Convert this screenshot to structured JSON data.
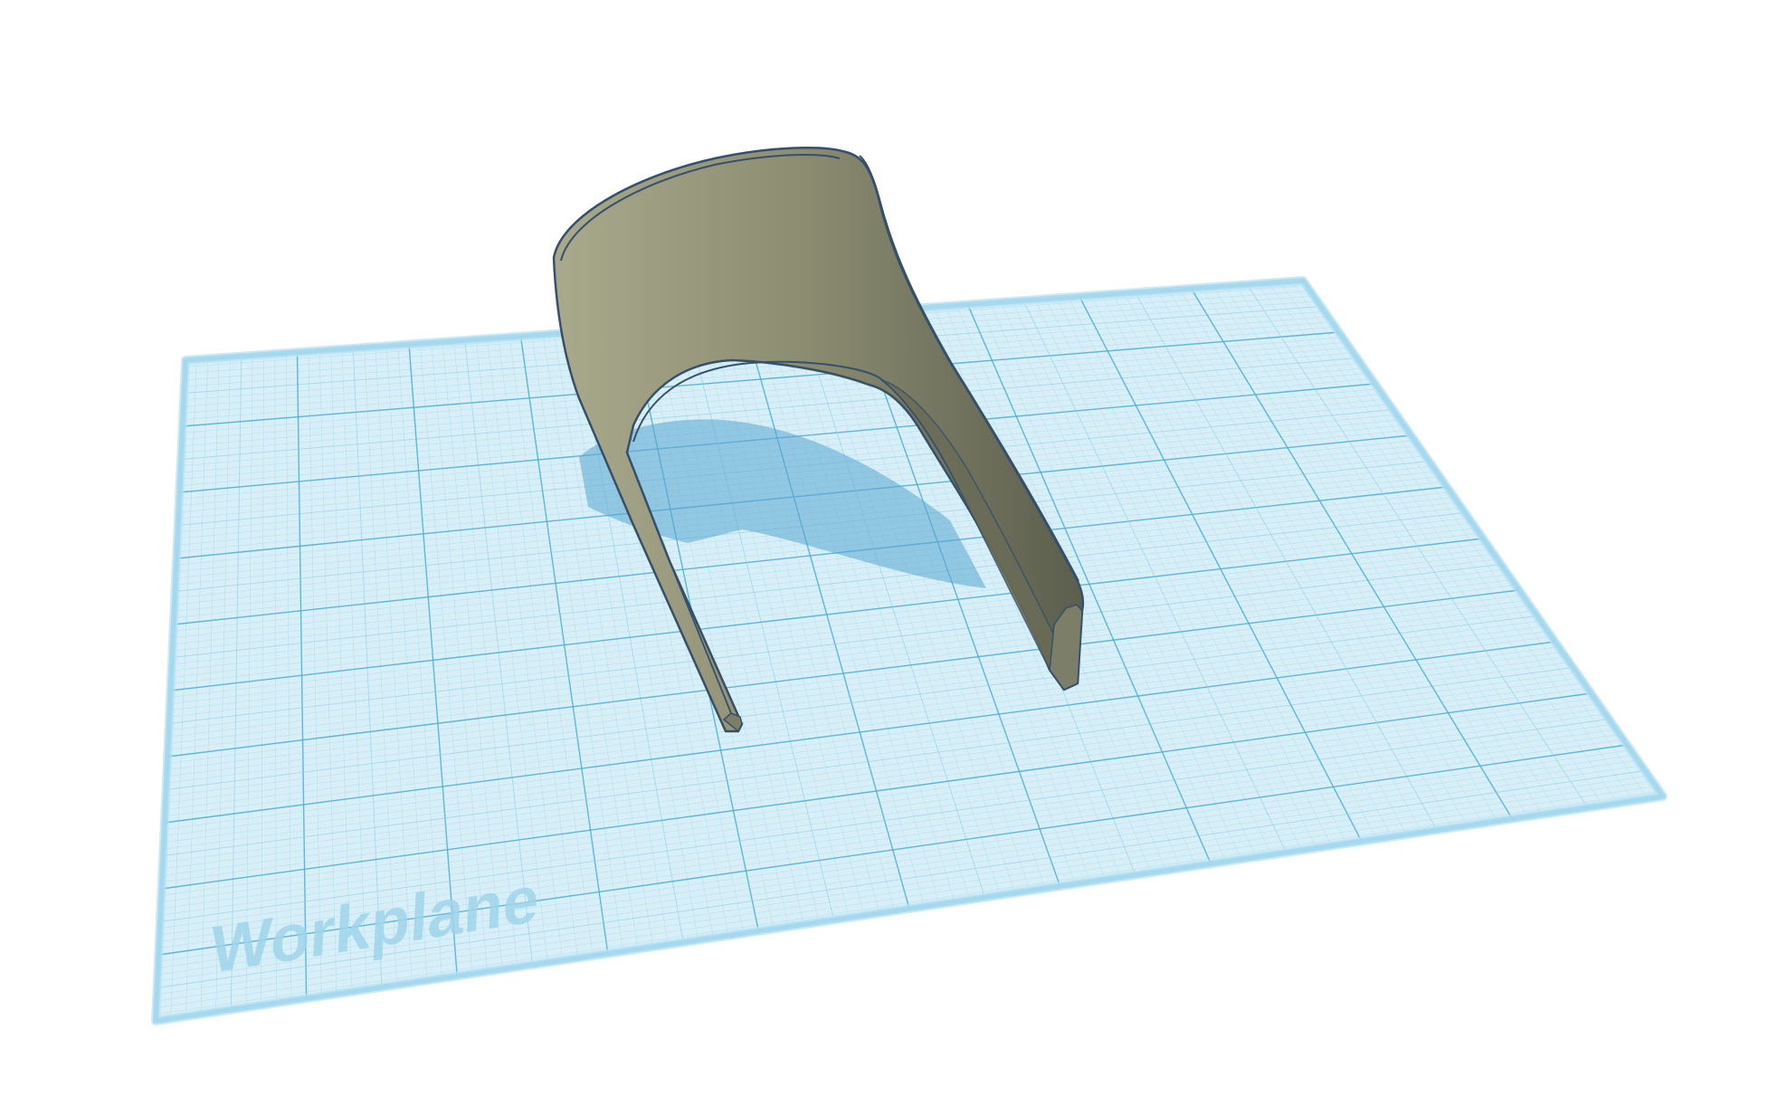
{
  "workplane": {
    "label": "Workplane",
    "colors": {
      "plane_fill": "#d6eef8",
      "grid_minor": "#8fd0ea",
      "grid_major": "#4fb0d8",
      "border": "#6cc0e2",
      "label": "#9fd3ea"
    }
  },
  "shape": {
    "name": "curved-bracket",
    "colors": {
      "face_light": "#a7a78a",
      "face_dark": "#5f6150",
      "outline": "#36506a",
      "shadow": "#5da7cf"
    }
  }
}
